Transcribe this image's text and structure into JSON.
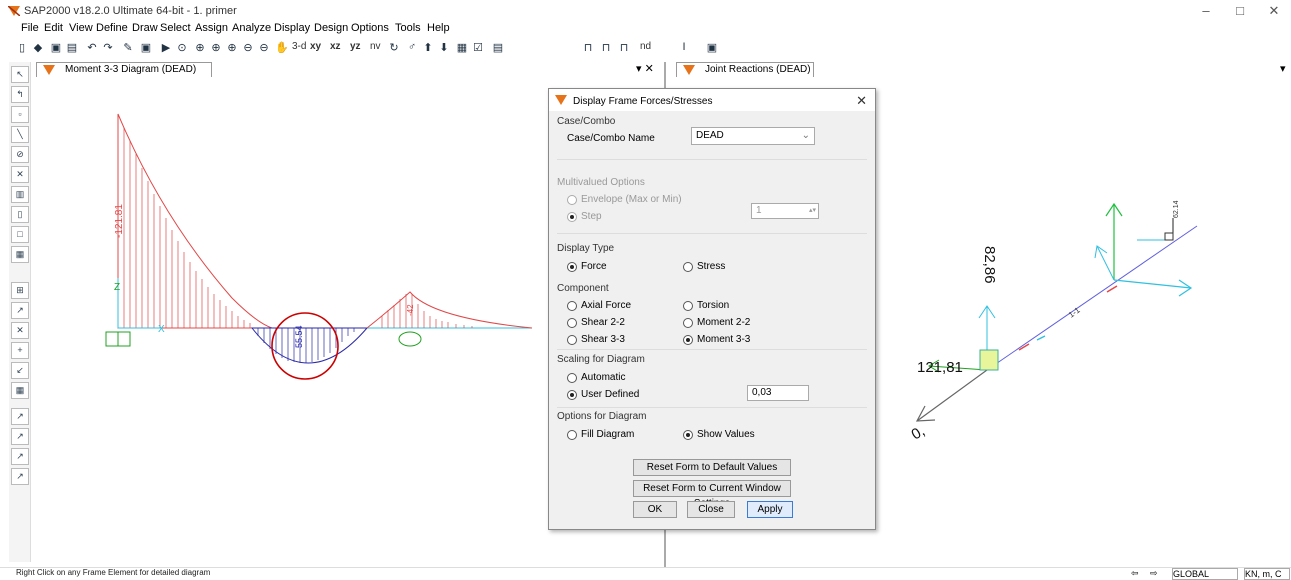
{
  "app": {
    "title": "SAP2000 v18.2.0 Ultimate 64-bit - 1. primer",
    "window_controls": [
      "–",
      "□",
      "✕"
    ]
  },
  "menu": [
    "File",
    "Edit",
    "View",
    "Define",
    "Draw",
    "Select",
    "Assign",
    "Analyze",
    "Display",
    "Design",
    "Options",
    "Tools",
    "Help"
  ],
  "toolbar": {
    "view_labels": [
      "3-d",
      "xy",
      "xz",
      "yz",
      "nv"
    ],
    "nd_label": "nd"
  },
  "panels": {
    "left_tab": "Moment 3-3 Diagram (DEAD)",
    "right_tab": "Joint Reactions  (DEAD)",
    "close_glyph": "▾ ✕"
  },
  "left_diagram": {
    "values": {
      "neg_moment": "-121.81",
      "mid_moment": "55.54",
      "right_moment": "-42"
    },
    "axis_labels": {
      "z": "Z",
      "x": "X"
    }
  },
  "right_diagram": {
    "labels": {
      "vert": "82,86",
      "horiz": "121,81",
      "zero": "0,",
      "member": "1-1",
      "top_label": "62.14"
    }
  },
  "dialog": {
    "title": "Display Frame Forces/Stresses",
    "case_combo": {
      "group": "Case/Combo",
      "name_label": "Case/Combo Name",
      "value": "DEAD"
    },
    "multivalued": {
      "group": "Multivalued Options",
      "envelope": "Envelope (Max or Min)",
      "step": "Step",
      "step_value": "1"
    },
    "display_type": {
      "group": "Display Type",
      "force": "Force",
      "stress": "Stress"
    },
    "component": {
      "group": "Component",
      "axial": "Axial Force",
      "torsion": "Torsion",
      "shear22": "Shear 2-2",
      "moment22": "Moment 2-2",
      "shear33": "Shear 3-3",
      "moment33": "Moment 3-3"
    },
    "scaling": {
      "group": "Scaling for Diagram",
      "automatic": "Automatic",
      "user_defined": "User Defined",
      "value": "0,03"
    },
    "options": {
      "group": "Options for Diagram",
      "fill": "Fill Diagram",
      "show_values": "Show Values"
    },
    "buttons": {
      "reset_default": "Reset Form to Default Values",
      "reset_current": "Reset Form to Current Window Settings",
      "ok": "OK",
      "close": "Close",
      "apply": "Apply"
    }
  },
  "status": {
    "text": "Right Click on any Frame Element for detailed diagram",
    "coord_system": "GLOBAL",
    "units": "KN, m, C"
  },
  "colors": {
    "moment_neg": "#e04848",
    "moment_pos": "#2a2aa8",
    "highlight_circle": "#cc0000",
    "support": "#20a020",
    "axis_cyan": "#30c0e0"
  }
}
